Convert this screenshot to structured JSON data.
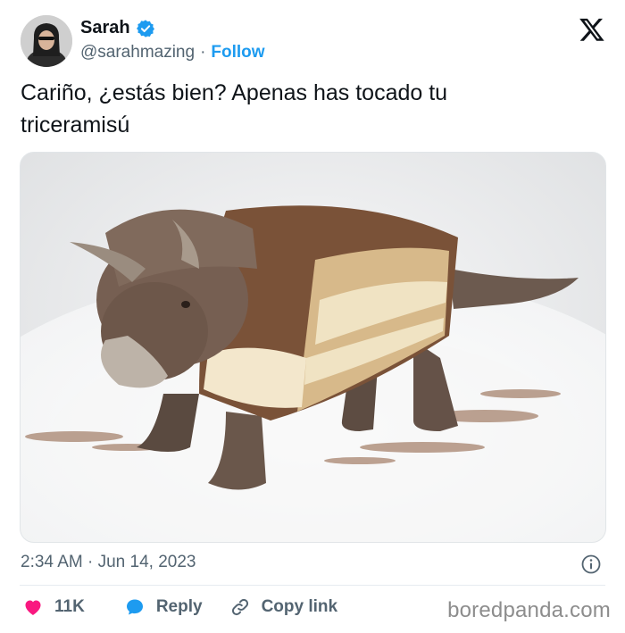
{
  "author": {
    "name": "Sarah",
    "handle": "@sarahmazing",
    "separator": "·",
    "follow_label": "Follow",
    "verified_icon": "verified-badge-icon"
  },
  "tweet": {
    "text": "Cariño, ¿estás bien? Apenas has tocado tu\ntriceramisú",
    "timestamp": "2:34 AM · Jun 14, 2023"
  },
  "actions": {
    "likes_count": "11K",
    "reply_label": "Reply",
    "copy_label": "Copy link"
  },
  "watermark": "boredpanda.com",
  "colors": {
    "accent": "#1d9bf0",
    "like": "#f91880",
    "text": "#0f1419",
    "muted": "#536471"
  }
}
